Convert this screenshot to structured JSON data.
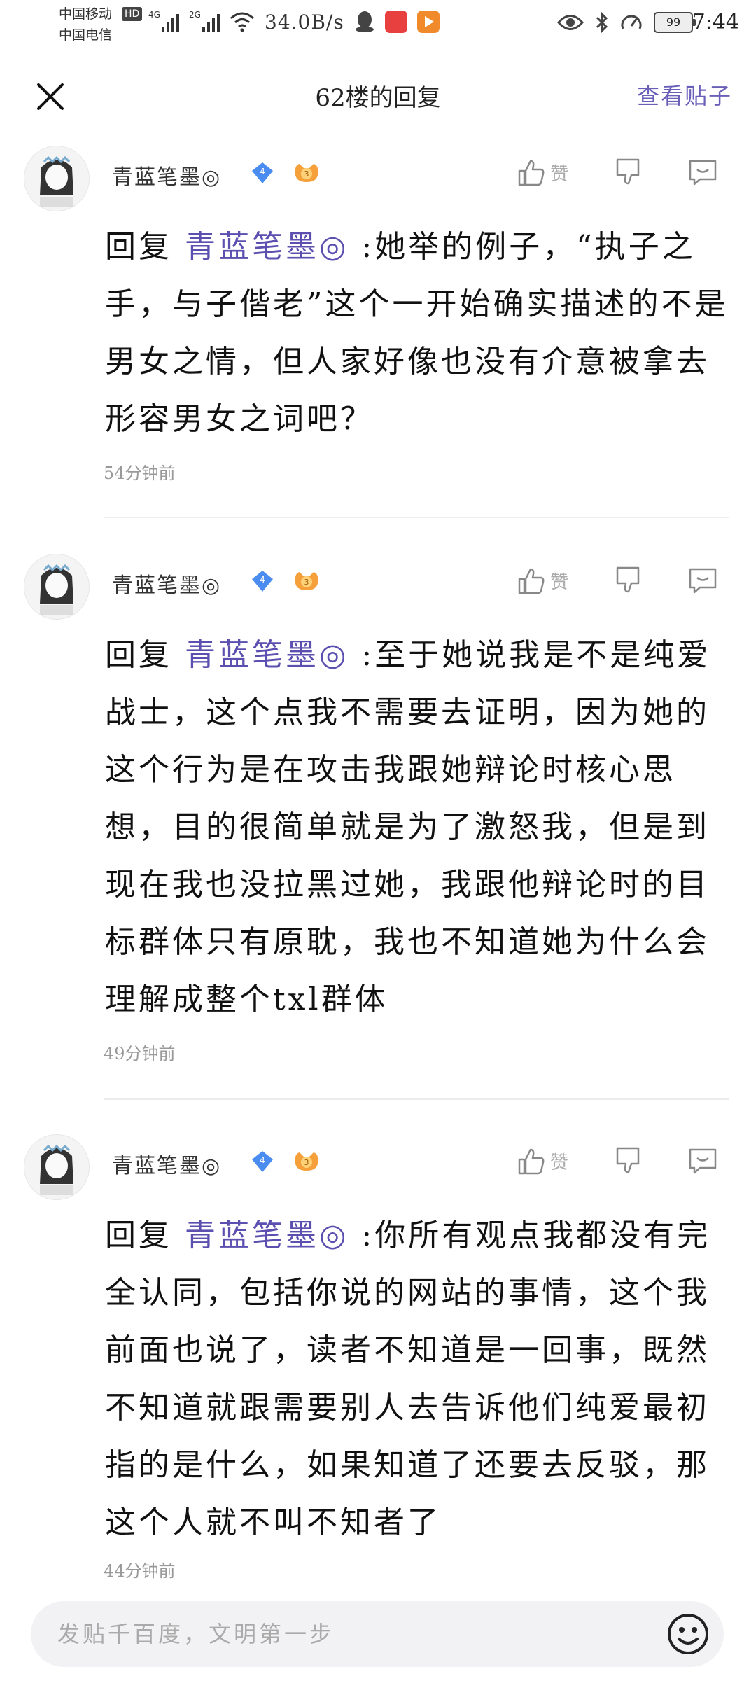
{
  "status_bar": {
    "carrier1": "中国移动",
    "hd": "HD",
    "carrier2": "中国电信",
    "sig1_label": "4G",
    "sig2_label": "2G",
    "net_speed": "34.0B/s",
    "battery": "99",
    "time": "7:44"
  },
  "header": {
    "title": "62楼的回复",
    "view_post": "查看贴子"
  },
  "replies": [
    {
      "username": "青蓝笔墨◎",
      "level": "4",
      "fan_level": "3",
      "like_label": "赞",
      "prefix": "回复 ",
      "mention": "青蓝笔墨◎",
      "text": " :她举的例子，“执子之手，与子偕老”这个一开始确实描述的不是男女之情，但人家好像也没有介意被拿去形容男女之词吧？",
      "time": "54分钟前"
    },
    {
      "username": "青蓝笔墨◎",
      "level": "4",
      "fan_level": "3",
      "like_label": "赞",
      "prefix": "回复 ",
      "mention": "青蓝笔墨◎",
      "text": " :至于她说我是不是纯爱战士，这个点我不需要去证明，因为她的这个行为是在攻击我跟她辩论时核心思想，目的很简单就是为了激怒我，但是到现在我也没拉黑过她，我跟他辩论时的目标群体只有原耽，我也不知道她为什么会理解成整个txl群体",
      "time": "49分钟前"
    },
    {
      "username": "青蓝笔墨◎",
      "level": "4",
      "fan_level": "3",
      "like_label": "赞",
      "prefix": "回复 ",
      "mention": "青蓝笔墨◎",
      "text": " :你所有观点我都没有完全认同，包括你说的网站的事情，这个我前面也说了，读者不知道是一回事，既然不知道就跟需要别人去告诉他们纯爱最初指的是什么，如果知道了还要去反驳，那这个人就不叫不知者了",
      "time": "44分钟前"
    }
  ],
  "bottom": {
    "placeholder": "发贴千百度，文明第一步"
  }
}
